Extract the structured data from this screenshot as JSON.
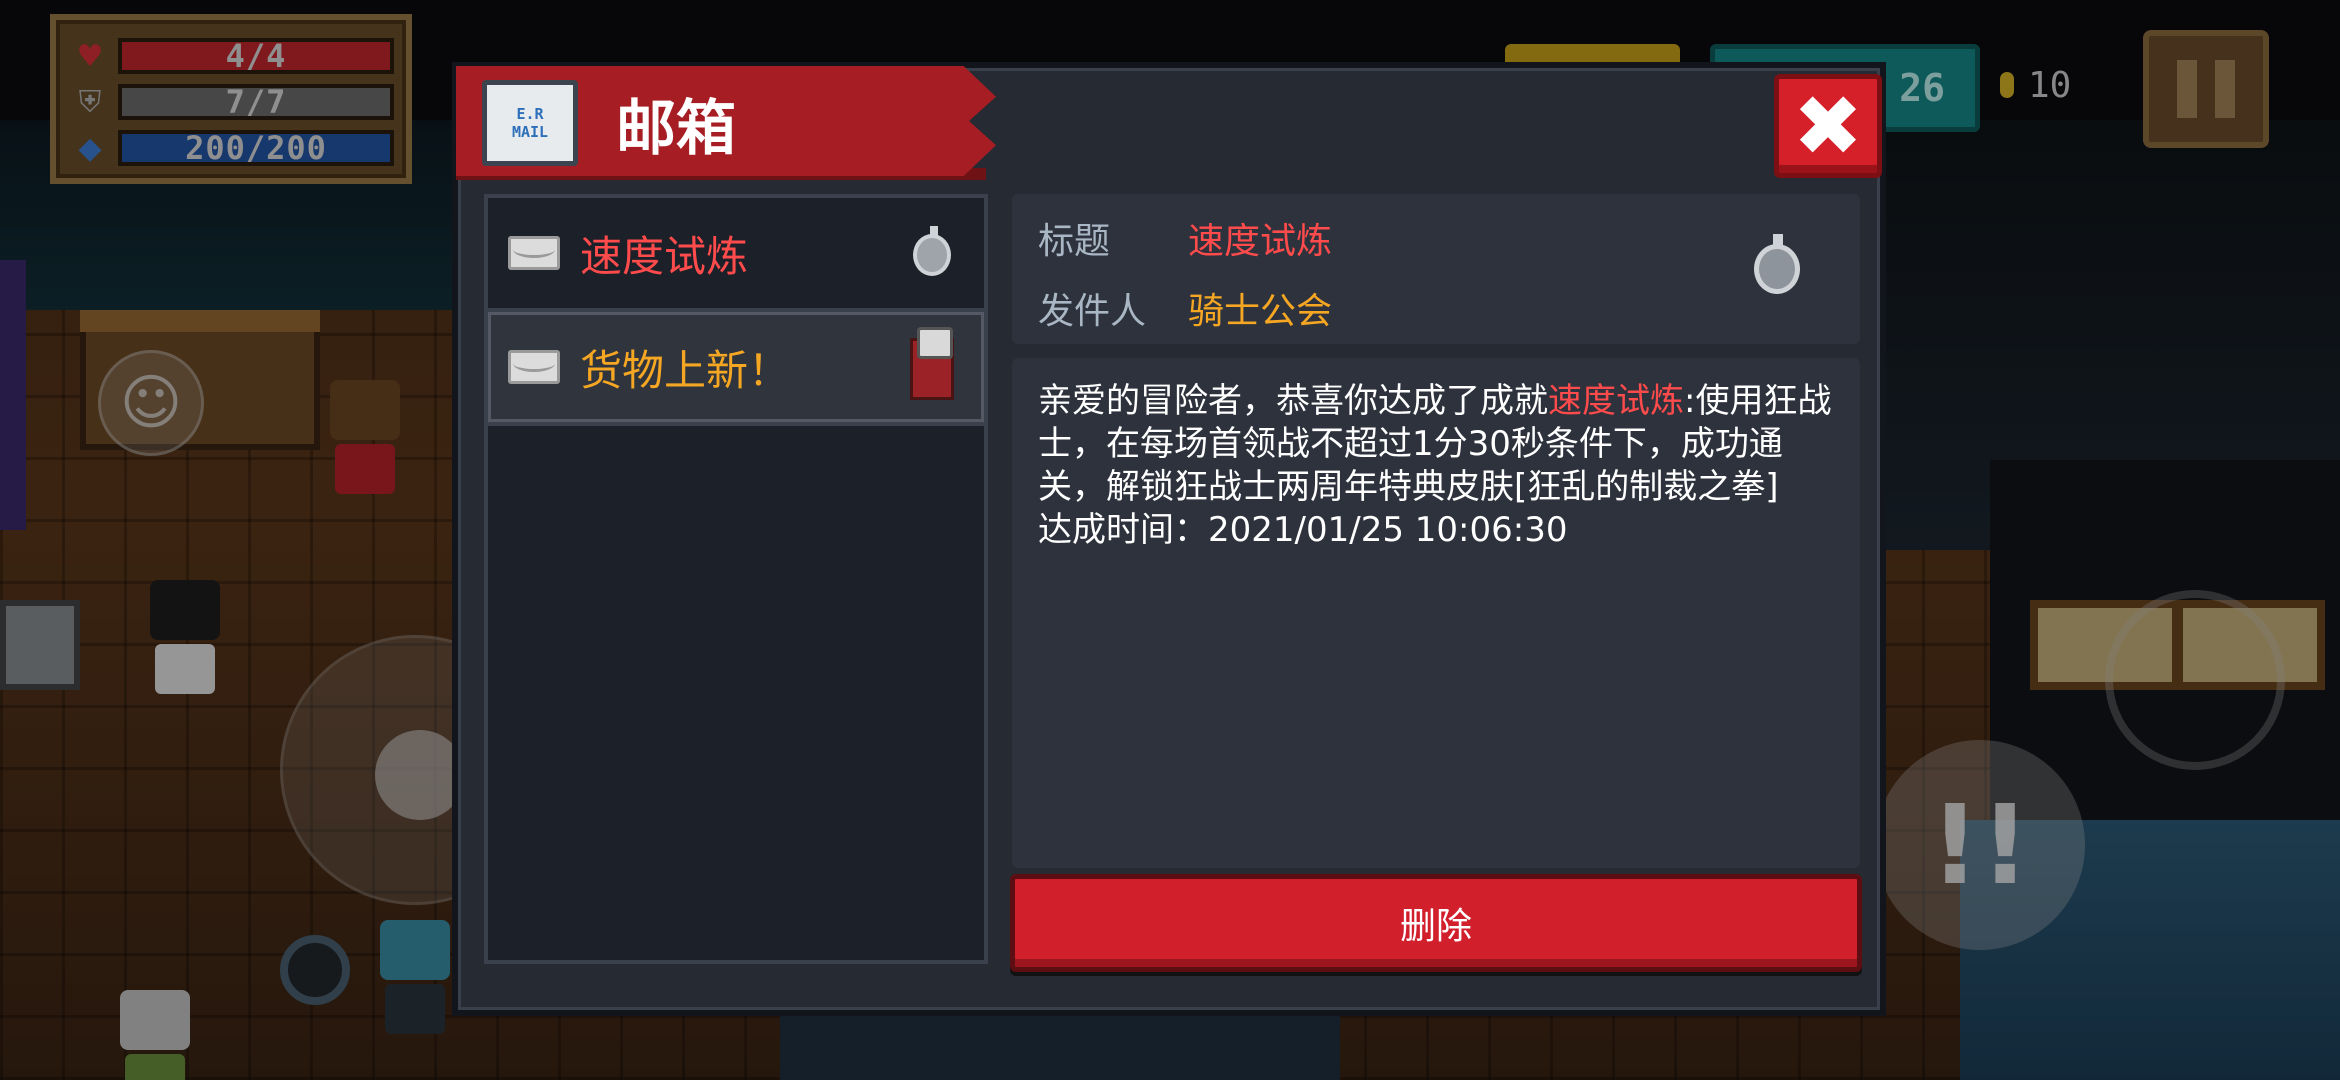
{
  "hud": {
    "health": "4/4",
    "armor": "7/7",
    "energy": "200/200",
    "gem_count": "26",
    "gold_count": "10",
    "colors": {
      "health": "#c5272d",
      "armor": "#6e6e6e",
      "energy": "#2456a8"
    }
  },
  "mailbox": {
    "title": "邮箱",
    "mail_icon_text_top": "E.R",
    "mail_icon_text_bottom": "MAIL",
    "items": [
      {
        "title": "速度试炼",
        "color": "#ff4b4b",
        "thumb": "stopwatch-icon"
      },
      {
        "title": "货物上新！",
        "color": "#f5a623",
        "thumb": "cat-merchant-icon"
      }
    ],
    "detail": {
      "subject_label": "标题",
      "subject_value": "速度试炼",
      "sender_label": "发件人",
      "sender_value": "骑士公会",
      "body_part1": "亲爱的冒险者，恭喜你达成了成就",
      "body_highlight": "速度试炼",
      "body_part2": ":使用狂战士，在每场首领战不超过1分30秒条件下，成功通关，解锁狂战士两周年特典皮肤[狂乱的制裁之拳]",
      "achieved_label": "达成时间：",
      "achieved_time": "2021/01/25 10:06:30"
    },
    "delete_label": "删除",
    "close_symbol": "✖"
  },
  "controls": {
    "emote_symbol": "☺",
    "skill_symbol": "!!"
  }
}
